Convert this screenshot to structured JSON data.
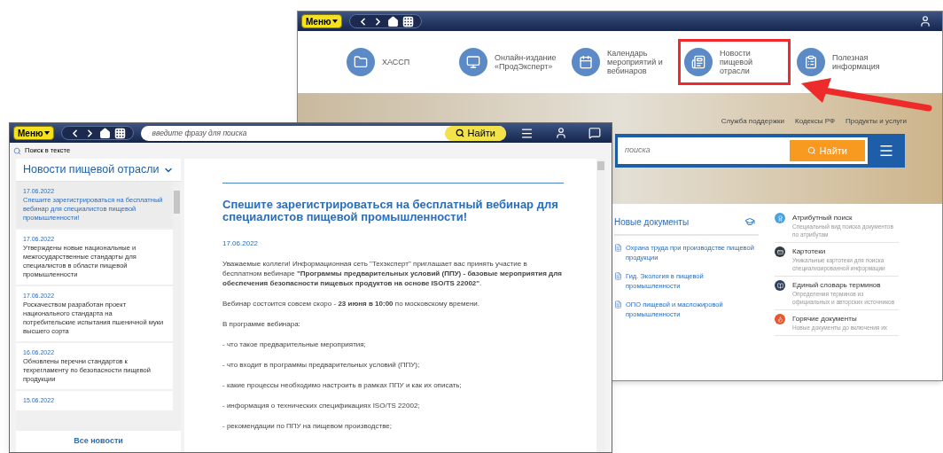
{
  "back_window": {
    "menu_button": "Меню",
    "tiles": [
      {
        "kind": "folder",
        "label": "ХАССП",
        "highlighted": false
      },
      {
        "kind": "monitor",
        "label": "Онлайн-издание «ПродЭксперт»",
        "highlighted": false
      },
      {
        "kind": "calendar",
        "label": "Календарь мероприятий и вебинаров",
        "highlighted": false
      },
      {
        "kind": "news",
        "label": "Новости пищевой отрасли",
        "highlighted": true
      },
      {
        "kind": "info",
        "label": "Полезная информация",
        "highlighted": false
      }
    ],
    "banner_links": [
      "Служба поддержки",
      "Кодексы РФ",
      "Продукты и услуги"
    ],
    "search": {
      "placeholder": "поиска",
      "button": "Найти"
    },
    "new_documents": {
      "title": "Новые документы",
      "items": [
        "Охрана труда при производстве пищевой продукции",
        "Гид. Экология в пищевой промышленности",
        "ОПО пищевой и масложировой промышленности"
      ]
    },
    "services": [
      {
        "kind": "attr",
        "title": "Атрибутный поиск",
        "description": "Специальный вид поиска документов по атрибутам"
      },
      {
        "kind": "cards",
        "title": "Картотеки",
        "description": "Уникальные картотеки для поиска специализированной информации"
      },
      {
        "kind": "dict",
        "title": "Единый словарь терминов",
        "description": "Определения терминов из официальных и авторских источников"
      },
      {
        "kind": "hot",
        "title": "Горячие документы",
        "description": "Новые документы до включения их"
      }
    ]
  },
  "front_window": {
    "menu_button": "Меню",
    "search": {
      "placeholder": "введите фразу для поиска",
      "button": "Найти"
    },
    "toolbar": {
      "search_in_text": "Поиск в тексте"
    },
    "sidebar": {
      "title": "Новости пищевой отрасли",
      "all_news": "Все новости",
      "items": [
        {
          "date": "17.06.2022",
          "title": "Спешите зарегистрироваться на бесплатный вебинар для специалистов пищевой промышленности!",
          "selected": true
        },
        {
          "date": "17.06.2022",
          "title": "Утверждены новые национальные и межгосударственные стандарты для специалистов в области пищевой промышленности",
          "selected": false
        },
        {
          "date": "17.06.2022",
          "title": "Роскачеством разработан проект национального стандарта на потребительские испытания пшеничной муки высшего сорта",
          "selected": false
        },
        {
          "date": "16.06.2022",
          "title": "Обновлены перечни стандартов к техрегламенту по безопасности пищевой продукции",
          "selected": false
        },
        {
          "date": "15.06.2022",
          "selected": false
        }
      ]
    },
    "article": {
      "title": "Спешите зарегистрироваться на бесплатный вебинар для специалистов пищевой промышленности!",
      "date": "17.06.2022",
      "paragraphs": [
        "Уважаемые коллеги! Информационная сеть \"Техэксперт\" приглашает вас принять участие в бесплатном вебинаре **\"Программы предварительных условий (ППУ) - базовые мероприятия для обеспечения безопасности пищевых продуктов на основе ISO/TS 22002\"**.",
        "Вебинар состоится совсем скоро - **23 июня в 10:00** по московскому времени.",
        "В программе вебинара:",
        "- что такое предварительные мероприятия;",
        "- что входит в программы предварительных условий (ППУ);",
        "- какие процессы необходимо настроить в рамках ППУ и как их описать;",
        "- информация о технических спецификациях ISO/TS 22002;",
        "- рекомендации по ППУ на пищевом производстве;"
      ]
    }
  }
}
